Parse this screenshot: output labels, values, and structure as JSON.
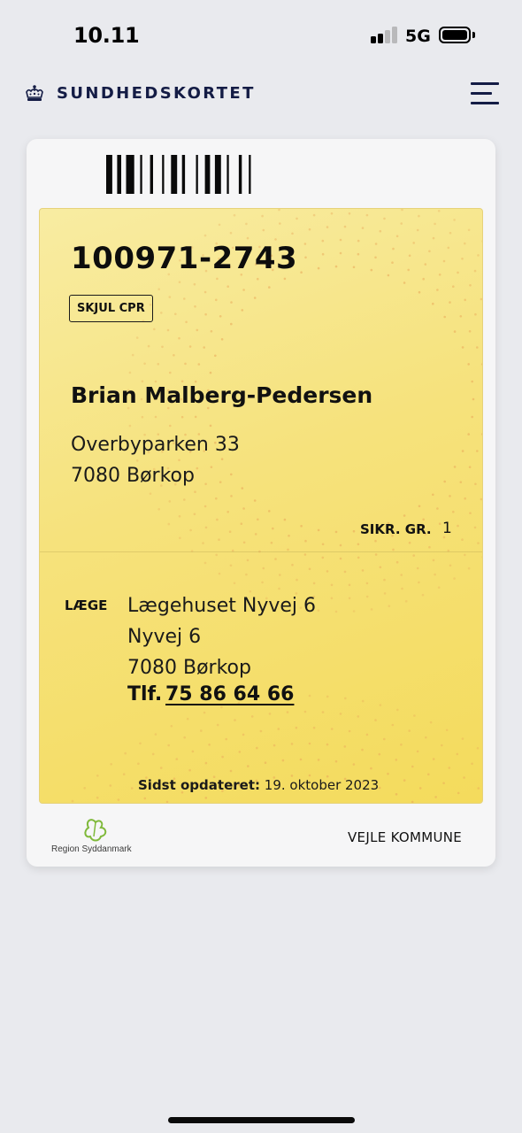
{
  "status_bar": {
    "time": "10.11",
    "network": "5G",
    "signal_bars_active": 2,
    "signal_bars_total": 4
  },
  "header": {
    "title": "SUNDHEDSKORTET",
    "icon_left": "crown-icon",
    "icon_right": "menu-icon"
  },
  "card": {
    "barcode_icon": "barcode",
    "cpr": "100971-2743",
    "hide_cpr_label": "SKJUL CPR",
    "name": "Brian Malberg-Pedersen",
    "address": {
      "street": "Overbyparken 33",
      "city": "7080 Børkop"
    },
    "insurance": {
      "label": "SIKR. GR.",
      "value": "1"
    },
    "doctor": {
      "label": "LÆGE",
      "clinic": "Lægehuset Nyvej 6",
      "street": "Nyvej 6",
      "city": "7080 Børkop",
      "phone_label": "Tlf.",
      "phone": "75 86 64 66"
    },
    "updated": {
      "label": "Sidst opdateret:",
      "date": "19. oktober 2023"
    },
    "footer": {
      "region_name": "Region Syddanmark",
      "municipality": "VEJLE KOMMUNE"
    }
  },
  "colors": {
    "header_navy": "#141c45",
    "panel_yellow": "#f6e27c",
    "dot_orange": "#e9a85a",
    "background": "#e9eaee"
  }
}
